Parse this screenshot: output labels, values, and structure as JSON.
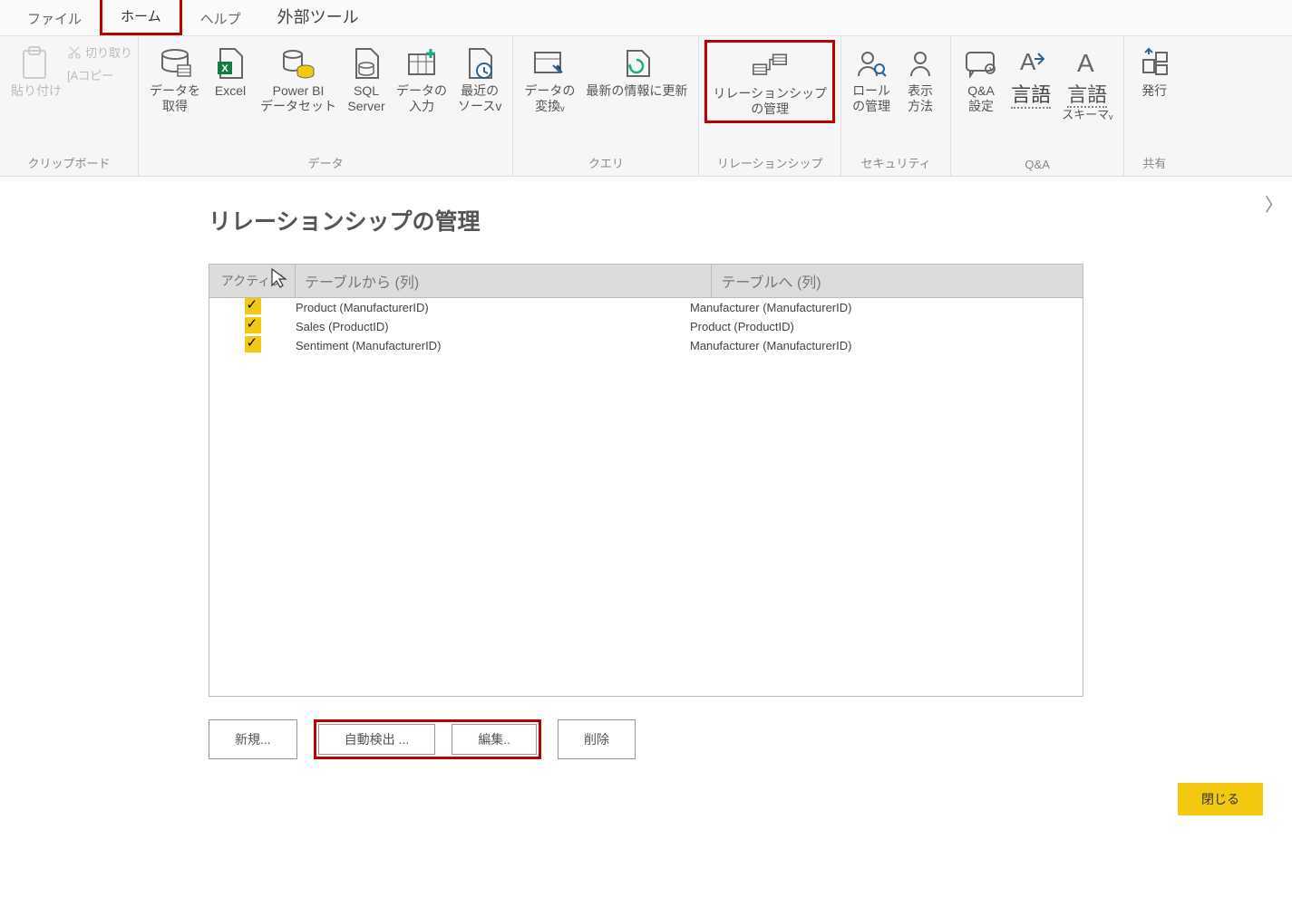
{
  "tabs": {
    "file": "ファイル",
    "home": "ホーム",
    "help": "ヘルプ",
    "external": "外部ツール"
  },
  "ribbon": {
    "clipboard": {
      "paste": "貼り付け",
      "cut": "切り取り",
      "copy": "[Aコピー",
      "group_label": "クリップボード"
    },
    "data": {
      "get_data": "データを\n取得",
      "excel": "Excel",
      "pbi_dataset": "Power BI\nデータセット",
      "sql_server": "SQL\nServer",
      "enter_data": "データの\n入力",
      "recent": "最近の\nソースv",
      "group_label": "データ"
    },
    "query": {
      "transform": "データの\n変換ᵥ",
      "refresh": "最新の情報に更新",
      "group_label": "クエリ"
    },
    "relationships": {
      "manage": "リレーションシップ\nの管理",
      "group_label": "リレーションシップ"
    },
    "security": {
      "manage_roles": "ロール\nの管理",
      "view_as": "表示\n方法",
      "group_label": "セキュリティ"
    },
    "qna": {
      "setup": "Q&A\n設定",
      "language": "言語",
      "schema": "言語\nスキーマᵥ",
      "group_label": "Q&A"
    },
    "share": {
      "publish": "発行",
      "group_label": "共有"
    }
  },
  "dialog": {
    "title": "リレーションシップの管理",
    "columns": {
      "active": "アクティブ",
      "from": "テーブルから (列)",
      "to": "テーブルへ (列)"
    },
    "rows": [
      {
        "active": true,
        "from": "Product (ManufacturerID)",
        "to": "Manufacturer (ManufacturerID)",
        "selected": true
      },
      {
        "active": true,
        "from": "Sales (ProductID)",
        "to": "Product (ProductID)",
        "selected": false
      },
      {
        "active": true,
        "from": "Sentiment (ManufacturerID)",
        "to": "Manufacturer (ManufacturerID)",
        "selected": false
      }
    ],
    "buttons": {
      "new": "新規...",
      "autodetect": "自動検出 ...",
      "edit": "編集..",
      "delete": "削除",
      "close": "閉じる"
    }
  }
}
